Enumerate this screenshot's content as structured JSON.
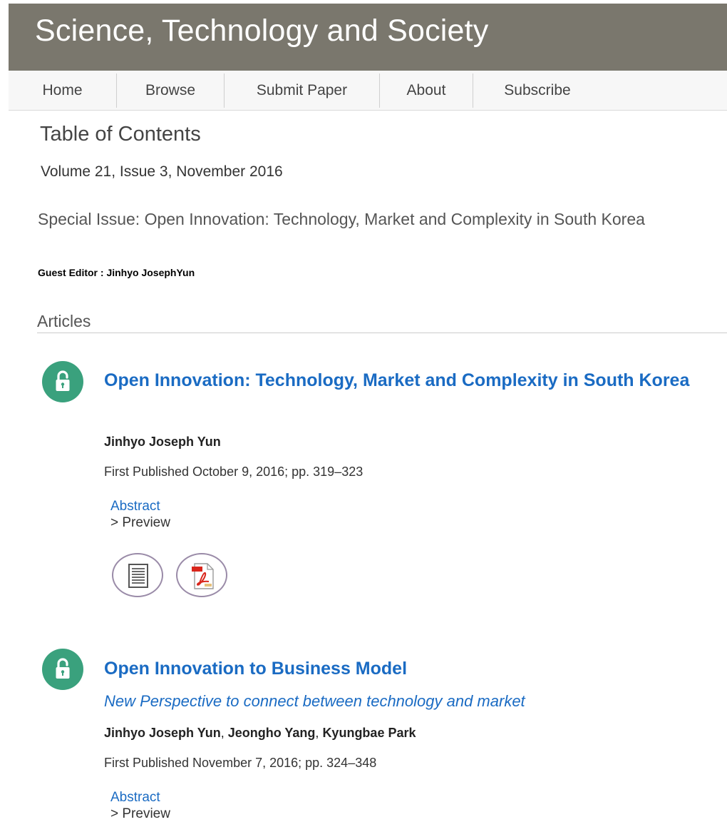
{
  "journal": {
    "title": "Science, Technology and Society"
  },
  "nav": {
    "items": [
      "Home",
      "Browse",
      "Submit Paper",
      "About",
      "Subscribe"
    ]
  },
  "toc": {
    "heading": "Table of Contents",
    "volume": "Volume 21, Issue 3, November 2016",
    "special_issue": "Special Issue: Open Innovation: Technology, Market and Complexity in South Korea",
    "guest_editor": "Guest Editor : Jinhyo JosephYun"
  },
  "section": {
    "title": "Articles"
  },
  "articles": [
    {
      "title": "Open Innovation: Technology, Market and Complexity in South Korea",
      "authors": [
        "Jinhyo Joseph Yun"
      ],
      "published": "First Published October 9, 2016; pp. 319–323",
      "abstract_label": "Abstract",
      "preview_label": "> Preview",
      "icons": [
        "open-access-icon",
        "full-text-icon",
        "pdf-icon"
      ]
    },
    {
      "title": "Open Innovation to Business Model",
      "subtitle": "New Perspective to connect between technology and market",
      "authors": [
        "Jinhyo Joseph Yun",
        "Jeongho Yang",
        "Kyungbae Park"
      ],
      "author_separator": ", ",
      "published": "First Published November 7, 2016; pp. 324–348",
      "abstract_label": "Abstract",
      "preview_label": "> Preview",
      "icons": [
        "open-access-icon"
      ]
    }
  ],
  "colors": {
    "banner": "#7a776d",
    "link": "#1a6bc3",
    "open_access": "#3aa17d",
    "icon_border": "#9a8ba8",
    "pdf_red": "#d9261c"
  }
}
